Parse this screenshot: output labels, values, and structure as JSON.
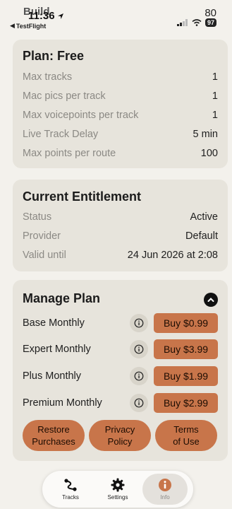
{
  "status_bar": {
    "ghost_left": "Build",
    "time": "11:36",
    "back_label": "TestFlight",
    "ghost_right": "80",
    "battery": "97"
  },
  "plan": {
    "title": "Plan: Free",
    "rows": [
      {
        "label": "Max tracks",
        "value": "1"
      },
      {
        "label": "Mac pics per track",
        "value": "1"
      },
      {
        "label": "Max voicepoints per track",
        "value": "1"
      },
      {
        "label": "Live Track Delay",
        "value": "5 min"
      },
      {
        "label": "Max points per route",
        "value": "100"
      }
    ]
  },
  "entitlement": {
    "title": "Current Entitlement",
    "rows": [
      {
        "label": "Status",
        "value": "Active"
      },
      {
        "label": "Provider",
        "value": "Default"
      },
      {
        "label": "Valid until",
        "value": "24 Jun 2026 at 2:08"
      }
    ]
  },
  "manage": {
    "title": "Manage Plan",
    "plans": [
      {
        "name": "Base Monthly",
        "buy_label": "Buy $0.99"
      },
      {
        "name": "Expert Monthly",
        "buy_label": "Buy $3.99"
      },
      {
        "name": "Plus Monthly",
        "buy_label": "Buy $1.99"
      },
      {
        "name": "Premium Monthly",
        "buy_label": "Buy $2.99"
      }
    ],
    "restore_line1": "Restore",
    "restore_line2": "Purchases",
    "privacy_line1": "Privacy",
    "privacy_line2": "Policy",
    "terms_line1": "Terms",
    "terms_line2": "of Use"
  },
  "tabs": [
    {
      "label": "Tracks",
      "icon": "route-icon"
    },
    {
      "label": "Settings",
      "icon": "gear-icon"
    },
    {
      "label": "Info",
      "icon": "info-icon"
    }
  ],
  "colors": {
    "accent": "#c8754a",
    "card": "#e7e4dc",
    "background": "#f3f1ec"
  }
}
